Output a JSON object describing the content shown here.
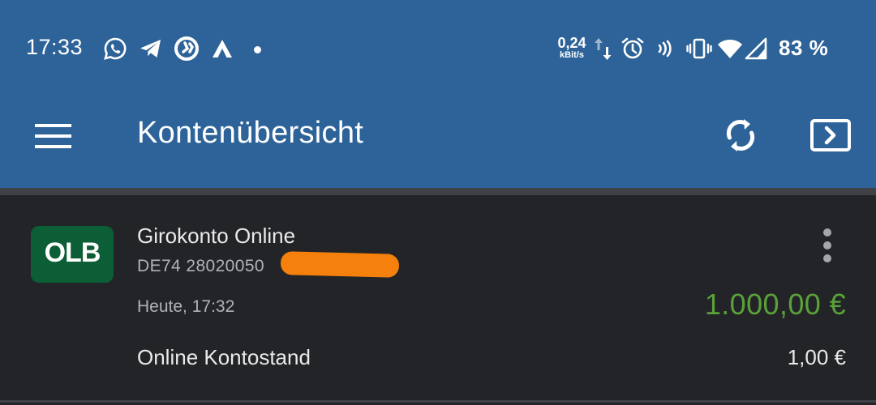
{
  "status_bar": {
    "time": "17:33",
    "network_speed_value": "0,24",
    "network_speed_unit": "kBit/s",
    "battery": "83 %",
    "notification_icons": [
      "whatsapp-icon",
      "telegram-icon",
      "app-icon",
      "arrow-a-icon",
      "dot"
    ],
    "system_icons": [
      "data-transfer-icon",
      "alarm-icon",
      "nfc-icon",
      "vibrate-icon",
      "wifi-icon",
      "signal-icon"
    ]
  },
  "toolbar": {
    "title": "Kontenübersicht",
    "menu_icon": "hamburger-menu-icon",
    "sync_icon": "sync-icon",
    "logout_icon": "logout-icon"
  },
  "account": {
    "bank_logo_text": "OLB",
    "name": "Girokonto Online",
    "iban": "DE74 28020050",
    "updated": "Heute, 17:32",
    "balance": "1.000,00 €",
    "online_label": "Online Kontostand",
    "online_value": "1,00 €"
  },
  "colors": {
    "app_bar": "#2d6399",
    "background": "#232427",
    "balance_positive": "#5aa13a",
    "logo_bg": "#0b5e35",
    "redaction": "#f5800b"
  }
}
